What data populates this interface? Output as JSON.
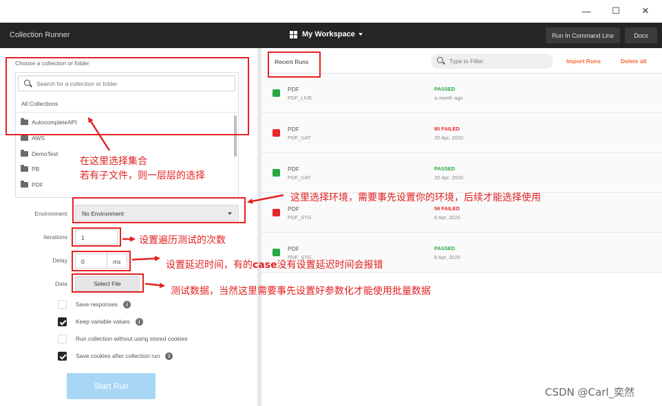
{
  "window": {
    "minimize_glyph": "—",
    "maximize_glyph": "☐",
    "close_glyph": "✕"
  },
  "header": {
    "title": "Collection Runner",
    "workspace": "My Workspace",
    "run_cmd_label": "Run In Command Line",
    "docs_label": "Docs"
  },
  "collections": {
    "choose_label": "Choose a collection or folder",
    "search_placeholder": "Search for a collection or folder",
    "all_label": "All Collections",
    "items": [
      {
        "label": "AutocompleteAPI"
      },
      {
        "label": "AWS"
      },
      {
        "label": "DemoTest"
      },
      {
        "label": "PB"
      },
      {
        "label": "PDF"
      }
    ]
  },
  "form": {
    "environment_label": "Environment",
    "environment_value": "No Environment",
    "iterations_label": "Iterations",
    "iterations_value": "1",
    "delay_label": "Delay",
    "delay_value": "0",
    "delay_unit": "ms",
    "data_label": "Data",
    "select_file_label": "Select File"
  },
  "options": [
    {
      "label": "Save responses",
      "checked": false,
      "info": true
    },
    {
      "label": "Keep variable values",
      "checked": true,
      "info": true
    },
    {
      "label": "Run collection without using stored cookies",
      "checked": false,
      "info": false
    },
    {
      "label": "Save cookies after collection run",
      "checked": true,
      "info": true
    }
  ],
  "start_run_label": "Start Run",
  "recent": {
    "tab_label": "Recent Runs",
    "filter_placeholder": "Type to Filter",
    "import_label": "Import Runs",
    "delete_label": "Delete all",
    "runs": [
      {
        "name": "PDF",
        "env": "PDF_LIVE",
        "status": "PASSED",
        "date": "a month ago",
        "color": "#28a745"
      },
      {
        "name": "PDF",
        "env": "PDF_UAT",
        "status": "80 FAILED",
        "date": "20 Apr, 2020",
        "color": "#e8262a"
      },
      {
        "name": "PDF",
        "env": "PDF_UAT",
        "status": "PASSED",
        "date": "20 Apr, 2020",
        "color": "#28a745"
      },
      {
        "name": "PDF",
        "env": "PDF_STG",
        "status": "58 FAILED",
        "date": "8 Apr, 2020",
        "color": "#e8262a"
      },
      {
        "name": "PDF",
        "env": "PDF_STG",
        "status": "PASSED",
        "date": "8 Apr, 2020",
        "color": "#28a745"
      }
    ]
  },
  "annotations": {
    "collection_line1": "在这里选择集合",
    "collection_line2": "若有子文件，则一层层的选择",
    "environment": "这里选择环境，需要事先设置你的环境，后续才能选择使用",
    "iterations": "设置遍历测试的次数",
    "delay_prefix": "设置延迟时间，有的",
    "delay_case": "case",
    "delay_suffix": "没有设置延迟时间会报错",
    "data": "测试数据，当然这里需要事先设置好参数化才能使用批量数据"
  },
  "watermark": "CSDN @Carl_奕然",
  "colors": {
    "accent": "#f26b3a",
    "annotation": "#e32020",
    "header_bg": "#252525",
    "start_run": "#a8d6f5"
  }
}
